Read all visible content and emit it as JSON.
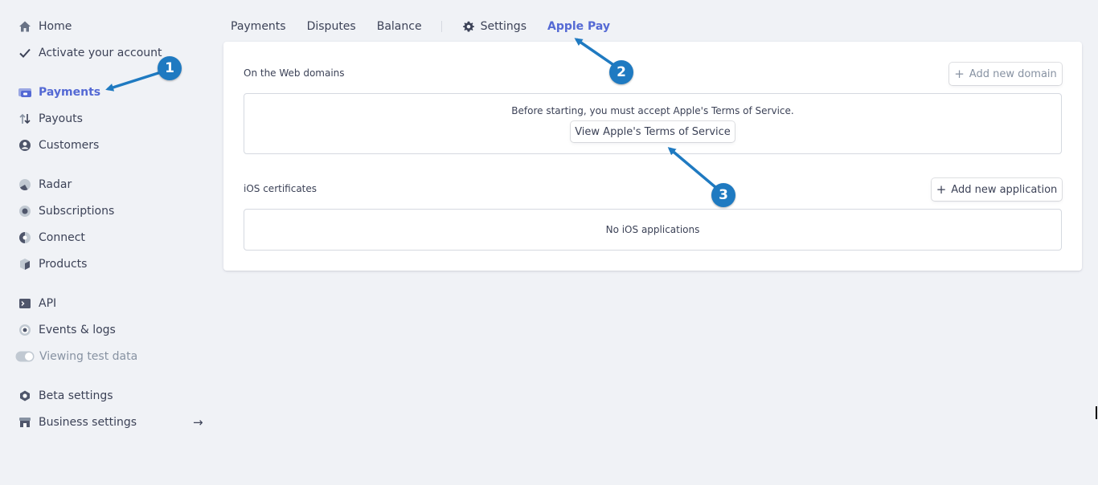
{
  "sidebar": {
    "items": [
      {
        "label": "Home",
        "icon": "home-icon"
      },
      {
        "label": "Activate your account",
        "icon": "checkmark-icon"
      },
      {
        "label": "Payments",
        "icon": "payments-icon"
      },
      {
        "label": "Payouts",
        "icon": "payouts-icon"
      },
      {
        "label": "Customers",
        "icon": "customer-icon"
      },
      {
        "label": "Radar",
        "icon": "radar-icon"
      },
      {
        "label": "Subscriptions",
        "icon": "subscriptions-icon"
      },
      {
        "label": "Connect",
        "icon": "connect-icon"
      },
      {
        "label": "Products",
        "icon": "box-icon"
      },
      {
        "label": "API",
        "icon": "terminal-icon"
      },
      {
        "label": "Events & logs",
        "icon": "events-icon"
      },
      {
        "label": "Viewing test data",
        "icon": "toggle-icon"
      },
      {
        "label": "Beta settings",
        "icon": "hexagon-icon"
      },
      {
        "label": "Business settings",
        "icon": "store-icon"
      }
    ],
    "active_item": "Payments",
    "business_arrow": "→"
  },
  "tabs": [
    "Payments",
    "Disputes",
    "Balance",
    "Settings",
    "Apple Pay"
  ],
  "active_tab": "Apple Pay",
  "card": {
    "web_domains": {
      "title": "On the Web domains",
      "add_button": "Add new domain",
      "message": "Before starting, you must accept Apple's Terms of Service.",
      "terms_button": "View Apple's Terms of Service"
    },
    "ios": {
      "title": "iOS certificates",
      "add_button": "Add new application",
      "empty_text": "No iOS applications"
    }
  },
  "annotations": {
    "color": "#1f7ac1",
    "badges": [
      "1",
      "2",
      "3"
    ]
  },
  "colors": {
    "accent": "#5469d4",
    "background": "#f0f2f6",
    "text": "#3c4257"
  }
}
